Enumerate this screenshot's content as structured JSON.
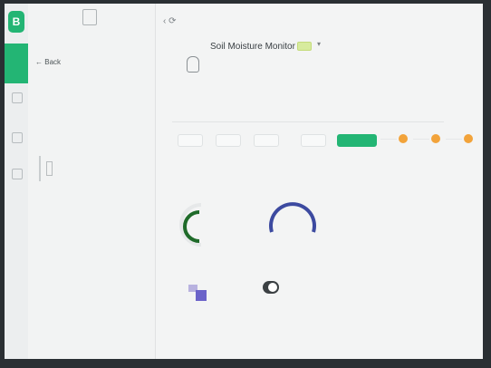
{
  "sidebar": {
    "logo": "B"
  },
  "panel": {
    "back_label": "Back"
  },
  "device": {
    "title": "Soil Moisture Monitor"
  },
  "colors": {
    "brand_green": "#23b574",
    "gauge_green": "#1f6b2a",
    "gauge_blue": "#3c4aa0",
    "dot_orange": "#f2a33a",
    "toggle_purple": "#6b63c9"
  },
  "icons": {
    "logo": "blynk-logo",
    "back": "arrow-left-icon",
    "device": "device-icon",
    "dot": "circle-dot-icon"
  }
}
